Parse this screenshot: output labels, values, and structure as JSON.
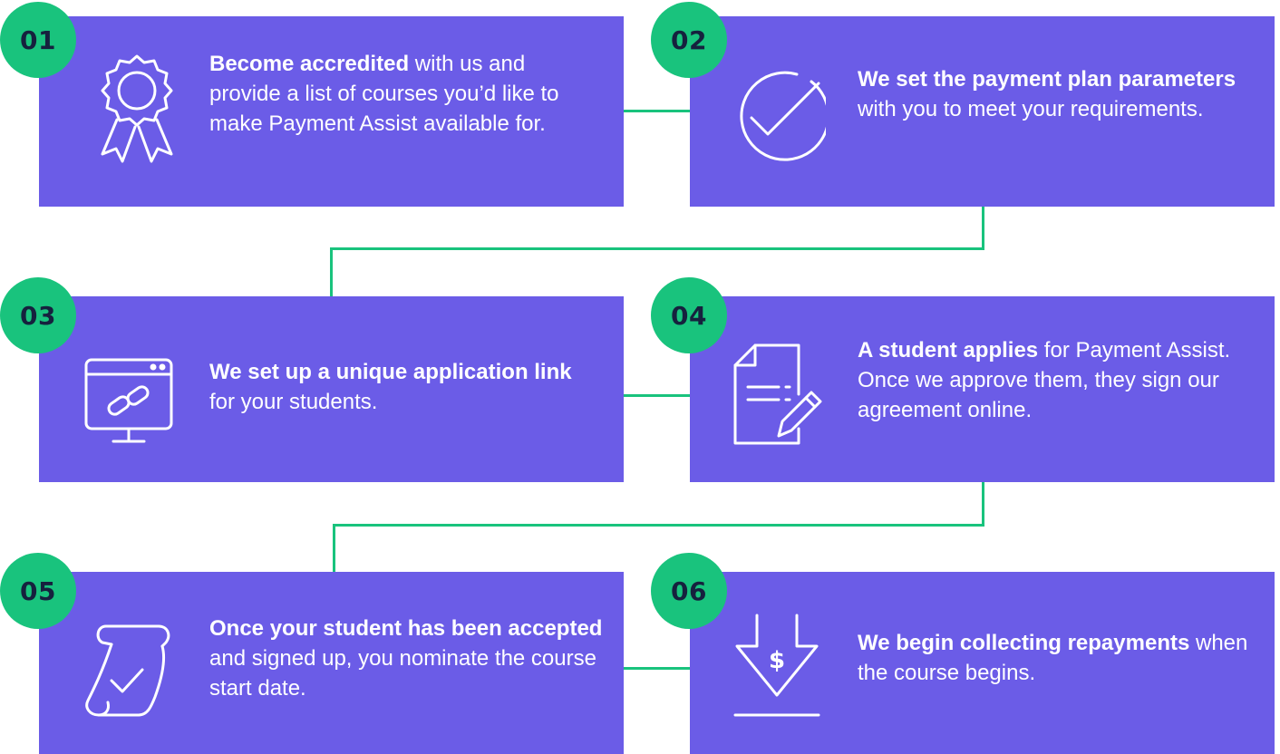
{
  "colors": {
    "card": "#6b5ce7",
    "badge": "#19c37d",
    "badge_text": "#16213e",
    "connector": "#19c37d"
  },
  "steps": [
    {
      "number": "01",
      "icon": "award-ribbon-icon",
      "bold": "Become accredited",
      "rest": " with us and provide a list of courses you’d like to make Payment Assist available for."
    },
    {
      "number": "02",
      "icon": "check-circle-icon",
      "bold": "We set the payment plan parameters",
      "rest": " with you to meet your requirements."
    },
    {
      "number": "03",
      "icon": "monitor-link-icon",
      "bold": "We set up a unique application link",
      "rest": " for your students."
    },
    {
      "number": "04",
      "icon": "document-pencil-icon",
      "bold": "A student applies",
      "rest": " for Payment Assist. Once we approve them, they sign our agreement online."
    },
    {
      "number": "05",
      "icon": "scroll-check-icon",
      "bold": "Once your student has been accepted",
      "rest": " and signed up, you nominate the course start date."
    },
    {
      "number": "06",
      "icon": "dollar-down-arrow-icon",
      "bold": "We begin collecting repayments",
      "rest": " when the course begins."
    }
  ]
}
